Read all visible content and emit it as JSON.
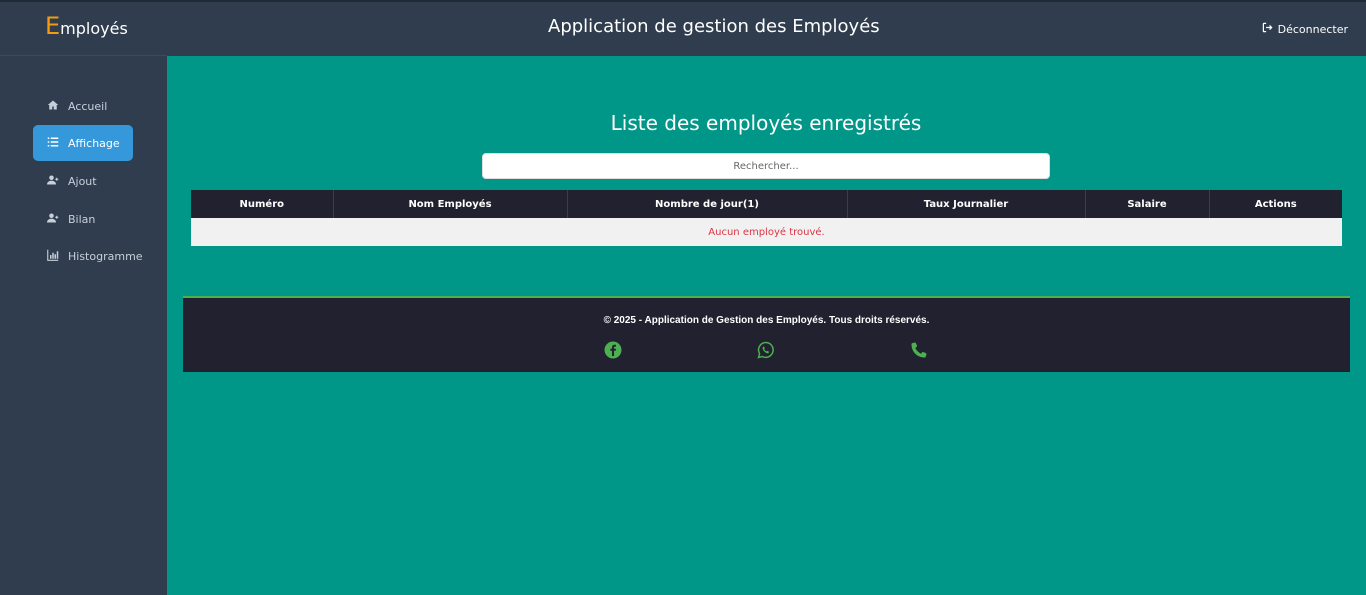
{
  "brand": {
    "first_letter": "E",
    "rest": "mployés"
  },
  "header": {
    "title": "Application de gestion des Employés",
    "logout_label": "Déconnecter"
  },
  "sidebar": {
    "items": [
      {
        "label": "Accueil",
        "icon": "home-icon"
      },
      {
        "label": "Affichage",
        "icon": "list-icon",
        "active": true
      },
      {
        "label": "Ajout",
        "icon": "user-plus-icon"
      },
      {
        "label": "Bilan",
        "icon": "user-plus-icon"
      },
      {
        "label": "Histogramme",
        "icon": "bar-chart-icon"
      }
    ]
  },
  "main": {
    "heading": "Liste des employés enregistrés",
    "search_placeholder": "Rechercher...",
    "table": {
      "columns": [
        "Numéro",
        "Nom Employés",
        "Nombre de jour(1)",
        "Taux Journalier",
        "Salaire",
        "Actions"
      ],
      "empty_message": "Aucun employé trouvé."
    }
  },
  "footer": {
    "copyright": "© 2025 - Application de Gestion des Employés. Tous droits réservés.",
    "social": [
      "facebook-icon",
      "whatsapp-icon",
      "phone-icon"
    ]
  },
  "colors": {
    "header_bg": "#2f3d4e",
    "content_bg": "#009688",
    "brand_accent": "#f39c12",
    "active_nav": "#3498db",
    "table_header": "#212130",
    "empty_text": "#dc3545",
    "footer_accent": "#4caf50"
  }
}
